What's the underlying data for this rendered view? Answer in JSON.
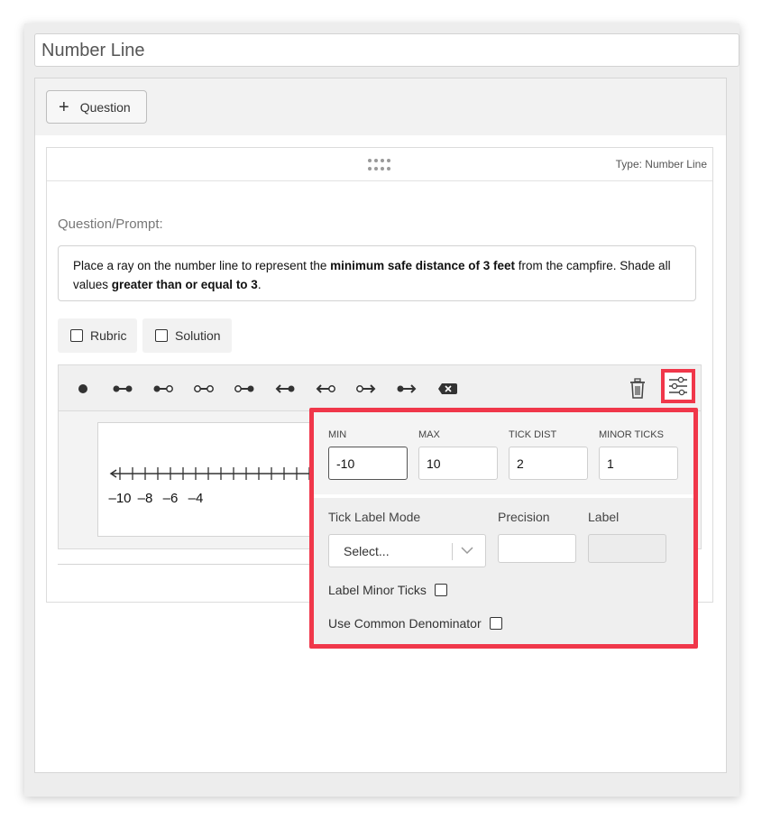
{
  "title_input": {
    "value": "Number Line"
  },
  "toolbar": {
    "add_question_label": "Question",
    "add_question_icon": "plus-icon"
  },
  "card": {
    "type_label": "Type: Number Line",
    "drag_icon": "drag-handle-icon",
    "prompt_label": "Question/Prompt:",
    "prompt": {
      "t1": "Place a ray on the number line to represent the ",
      "b1": "minimum safe distance of 3 feet",
      "t2": " from the campfire. Shade all values ",
      "b2": "greater than or equal to 3",
      "t3": "."
    },
    "options": [
      {
        "label": "Rubric",
        "checked": false
      },
      {
        "label": "Solution",
        "checked": false
      }
    ],
    "tools": [
      "point-icon",
      "segment-closed-closed-icon",
      "segment-closed-open-icon",
      "segment-open-open-icon",
      "segment-open-closed-icon",
      "ray-left-closed-icon",
      "ray-left-open-icon",
      "ray-right-open-icon",
      "ray-right-closed-icon",
      "clear-icon"
    ],
    "action_icons": [
      "trash-icon",
      "settings-sliders-icon"
    ],
    "number_line": {
      "tick_labels": [
        "–10",
        "–8",
        "–6",
        "–4"
      ]
    }
  },
  "settings": {
    "min": {
      "label": "MIN",
      "value": "-10"
    },
    "max": {
      "label": "MAX",
      "value": "10"
    },
    "tick_dist": {
      "label": "TICK DIST",
      "value": "2"
    },
    "minor_ticks": {
      "label": "MINOR TICKS",
      "value": "1"
    },
    "tick_label_mode": {
      "label": "Tick Label Mode",
      "placeholder": "Select..."
    },
    "precision": {
      "label": "Precision",
      "value": ""
    },
    "label": {
      "label": "Label",
      "value": ""
    },
    "label_minor_ticks": {
      "label": "Label Minor Ticks",
      "checked": false
    },
    "use_common_denominator": {
      "label": "Use Common Denominator",
      "checked": false
    }
  },
  "colors": {
    "highlight": "#f0374a",
    "panel": "#efefef",
    "border": "#d2d2d2"
  }
}
